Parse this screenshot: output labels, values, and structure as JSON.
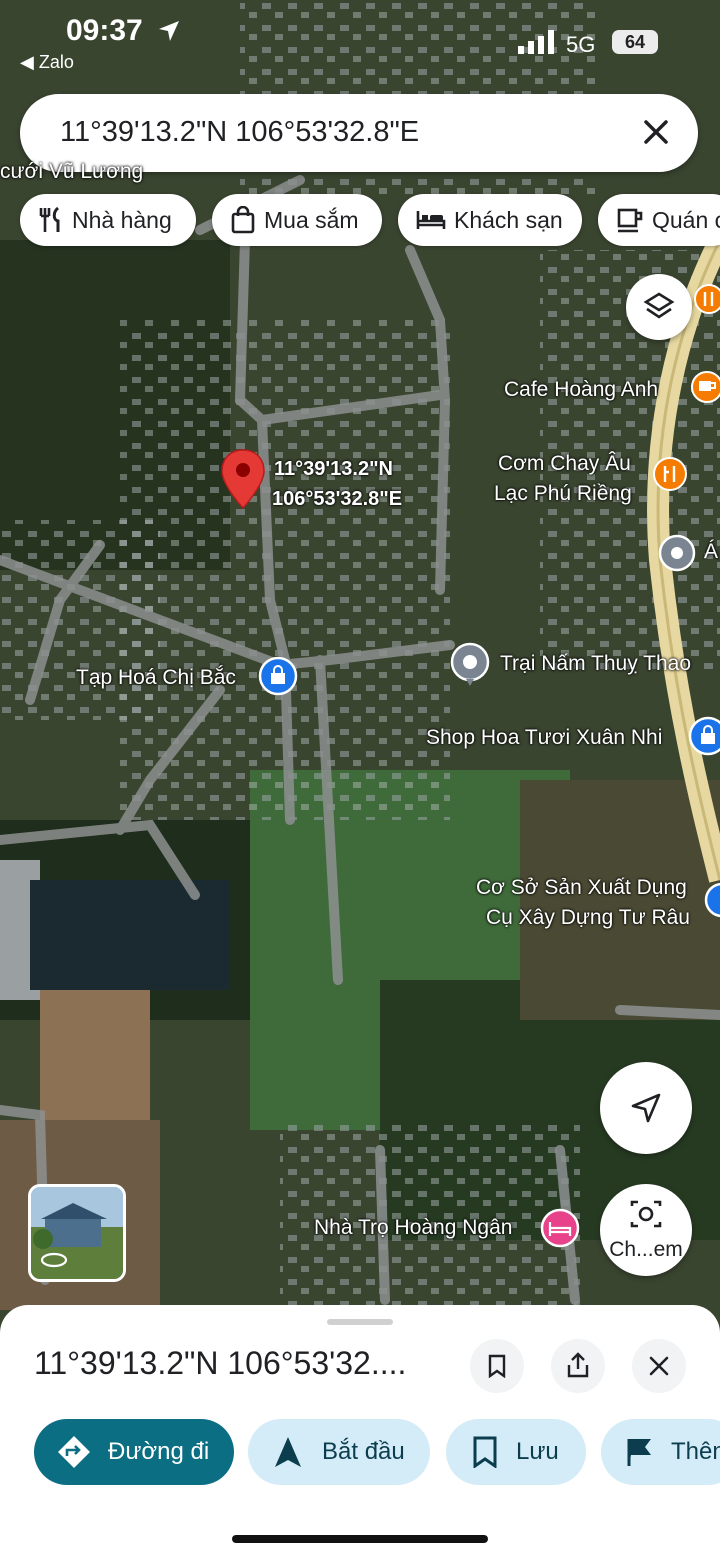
{
  "status_bar": {
    "time": "09:37",
    "back_app": "◀ Zalo",
    "network": "5G",
    "battery": "64"
  },
  "search": {
    "query": "11°39'13.2\"N 106°53'32.8\"E"
  },
  "chips": [
    {
      "label": "Nhà hàng",
      "icon": "restaurant-icon"
    },
    {
      "label": "Mua sắm",
      "icon": "shopping-bag-icon"
    },
    {
      "label": "Khách sạn",
      "icon": "hotel-bed-icon"
    },
    {
      "label": "Quán c",
      "icon": "coffee-cup-icon"
    }
  ],
  "map": {
    "top_label": "cưới Vũ Lương",
    "pin_label_line1": "11°39'13.2\"N",
    "pin_label_line2": "106°53'32.8\"E",
    "places": {
      "cafe": "Cafe Hoàng Anh",
      "com_chay_1": "Cơm Chay Âu",
      "com_chay_2": "Lạc Phú Riềng",
      "right_edge": "Á",
      "tap_hoa": "Tạp Hoá Chị Bắc",
      "trai_nam": "Trại Nấm Thuỵ Thao",
      "shop_hoa": "Shop Hoa Tươi Xuân Nhi",
      "co_so_1": "Cơ Sở Sản Xuất Dụng",
      "co_so_2": "Cụ Xây Dựng Tư Râu",
      "nha_tro": "Nhà Trọ Hoàng Ngân"
    },
    "camera_button_label": "Ch...em"
  },
  "sheet": {
    "title": "11°39'13.2\"N 106°53'32....",
    "actions": [
      {
        "label": "Đường đi"
      },
      {
        "label": "Bắt đầu"
      },
      {
        "label": "Lưu"
      },
      {
        "label": "Thêm"
      }
    ]
  },
  "colors": {
    "accent_primary": "#0b6e82",
    "action_bg": "#d3ecf7",
    "pin_red": "#e53935",
    "poi_orange": "#f57c00",
    "poi_blue": "#1a73e8",
    "poi_gray": "#7b8591",
    "poi_pink": "#e8438a",
    "highway": "#e6d8a0"
  }
}
